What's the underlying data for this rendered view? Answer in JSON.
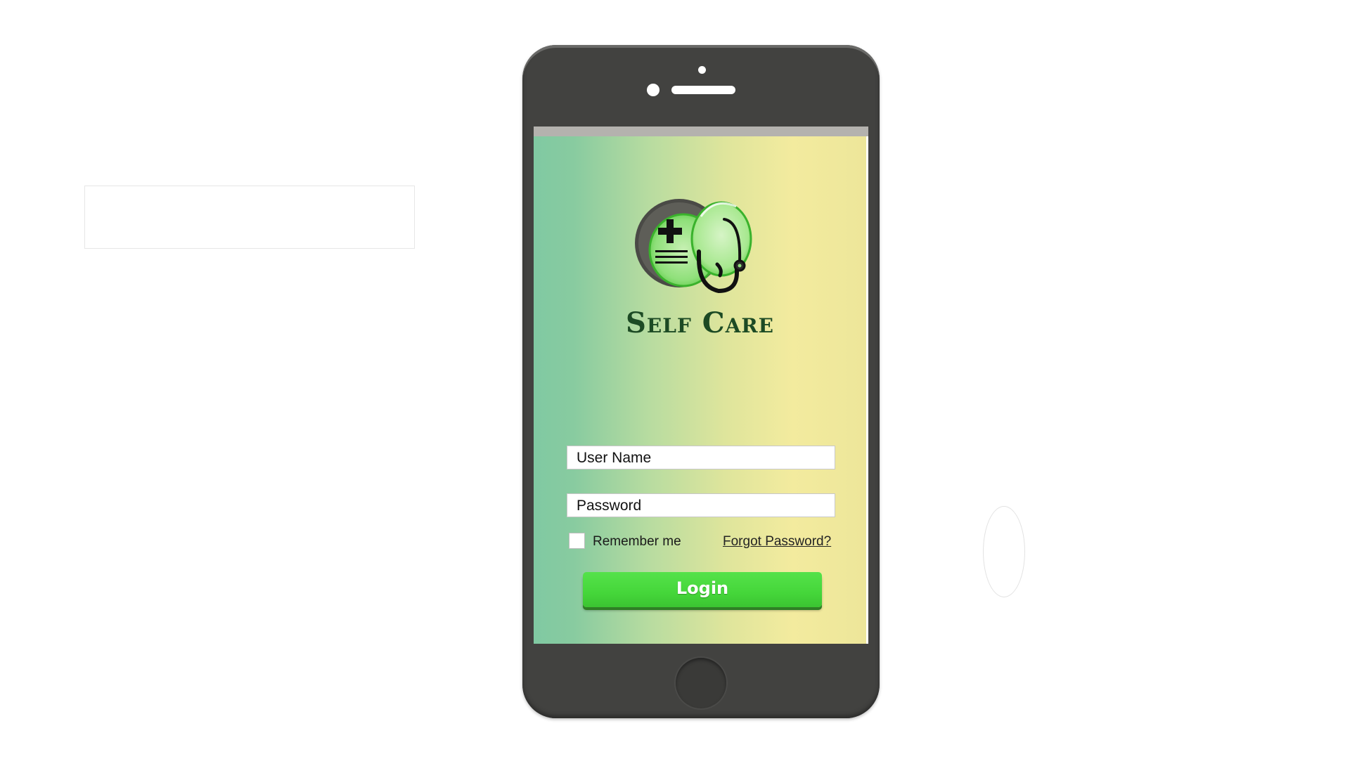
{
  "app": {
    "title": "Self Care"
  },
  "login_form": {
    "username_placeholder": "User Name",
    "password_placeholder": "Password",
    "remember_label": "Remember me",
    "remember_checked": false,
    "forgot_label": "Forgot Password?",
    "login_label": "Login"
  },
  "icons": {
    "logo": "medical-heart-stethoscope-logo"
  },
  "colors": {
    "accent": "#45d63a",
    "title_text": "#1c4a24",
    "phone_body": "#424240",
    "gradient_left": "#80c9a2",
    "gradient_right": "#f3eb9e"
  }
}
